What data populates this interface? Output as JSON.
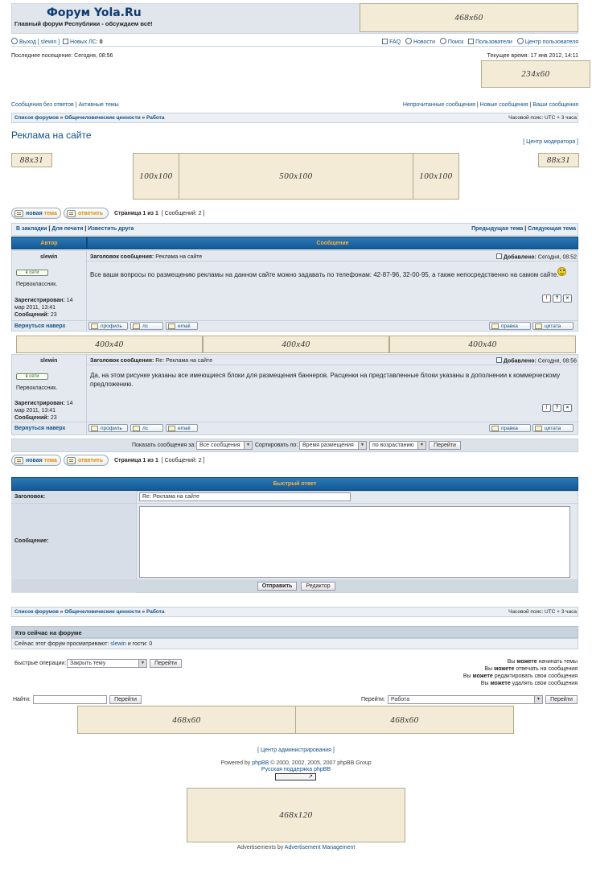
{
  "site": {
    "logo_title": "Форум Yola.Ru",
    "logo_subtitle": "Главный форум Республики - обсуждаем всё!"
  },
  "ads": {
    "top": "468x60",
    "right": "234x60",
    "small_left": "88x31",
    "small_right": "88x31",
    "box_left": "100x100",
    "box_center": "500x100",
    "box_right": "100x100",
    "between_1": "400x40",
    "between_2": "400x40",
    "between_3": "400x40",
    "bottom_left": "468x60",
    "bottom_right": "468x60",
    "footer": "468x120"
  },
  "topnav": {
    "logout": "Выход [ slewin ]",
    "new_pm_label": "Новых ЛС:",
    "new_pm_count": "0",
    "links": [
      "FAQ",
      "Новости",
      "Поиск",
      "Пользователи",
      "Центр пользователя"
    ]
  },
  "visit": {
    "last_visit": "Последнее посещение: Сегодня, 08:56",
    "current_time": "Текущее время: 17 янв 2012, 14:11"
  },
  "quicklinks": {
    "left_1": "Сообщения без ответов",
    "left_2": "Активные темы",
    "right_1": "Непрочитанные сообщения",
    "right_2": "Новые сообщения",
    "right_3": "Ваши сообщения"
  },
  "breadcrumb": {
    "items": [
      "Список форумов",
      "Общечеловеческие ценности",
      "Работа"
    ],
    "sep": "»",
    "timezone": "Часовой пояс: UTC + 3 часа"
  },
  "topic": {
    "title": "Реклама на сайте",
    "mod_center": "[ Центр модератора ]"
  },
  "buttons": {
    "new_topic_1": "новая",
    "new_topic_2": "тема",
    "reply": "ответить",
    "pagination": "Страница 1 из 1",
    "post_count": "[ Сообщений: 2 ]"
  },
  "toolbar": {
    "left_1": "В закладки",
    "left_2": "Для печати",
    "left_3": "Известить друга",
    "right_1": "Предыдущая тема",
    "right_2": "Следующая тема"
  },
  "table_header": {
    "author": "Автор",
    "message": "Сообщение"
  },
  "posts": [
    {
      "author": "slewin",
      "subject_label": "Заголовок сообщения:",
      "subject": "Реклама на сайте",
      "added_label": "Добавлено:",
      "added": "Сегодня, 08:52",
      "status": "в сети",
      "rank": "Первоклассник.",
      "reg_label": "Зарегистрирован:",
      "reg_date_1": "14",
      "reg_date_2": "мар 2011, 13:41",
      "msgs_label": "Сообщений:",
      "msgs": "23",
      "body": "Все ваши вопросы по размещению рекламы на данном сайте можно задавать по телефонам: 42-87-96, 32-00-95, а также непосредственно на самом сайте.",
      "back_top": "Вернуться наверх",
      "profile": "профиль",
      "pm": "лс",
      "email": "email",
      "edit": "правка",
      "quote": "цитата"
    },
    {
      "author": "slewin",
      "subject_label": "Заголовок сообщения:",
      "subject": "Re: Реклама на сайте",
      "added_label": "Добавлено:",
      "added": "Сегодня, 08:56",
      "status": "в сети",
      "rank": "Первоклассник.",
      "reg_label": "Зарегистрирован:",
      "reg_date_1": "14",
      "reg_date_2": "мар 2011, 13:41",
      "msgs_label": "Сообщений:",
      "msgs": "23",
      "body": "Да, на этом рисунке указаны все имеющиеся блоки для размещения баннеров. Расценки на представленные блоки указаны в дополнении к коммерческому предложению.",
      "back_top": "Вернуться наверх",
      "profile": "профиль",
      "pm": "лс",
      "email": "email",
      "edit": "правка",
      "quote": "цитата"
    }
  ],
  "sortbar": {
    "show_label": "Показать сообщения за:",
    "show_value": "Все сообщения",
    "sort_label": "Сортировать по:",
    "sort_value": "Время размещения",
    "order_value": "по возрастанию",
    "go": "Перейти"
  },
  "quick_reply": {
    "title": "Быстрый ответ",
    "subject_label": "Заголовок:",
    "subject_value": "Re: Реклама на сайте",
    "message_label": "Сообщение:",
    "send": "Отправить",
    "editor": "Редактор"
  },
  "online": {
    "title": "Кто сейчас на форуме",
    "text_1": "Сейчас этот форум просматривают:",
    "user": "slewin",
    "text_2": "и гости: 0"
  },
  "quick_ops": {
    "label": "Быстрые операции:",
    "value": "Закрыть тему",
    "go": "Перейти"
  },
  "perms": [
    {
      "pre": "Вы",
      "bold": "можете",
      "post": "начинать темы"
    },
    {
      "pre": "Вы",
      "bold": "можете",
      "post": "отвечать на сообщения"
    },
    {
      "pre": "Вы",
      "bold": "можете",
      "post": "редактировать свои сообщения"
    },
    {
      "pre": "Вы",
      "bold": "можете",
      "post": "удалять свои сообщения"
    }
  ],
  "search": {
    "label": "Найти:",
    "go": "Перейти",
    "jump_label": "Перейти:",
    "jump_value": "Работа",
    "jump_go": "Перейти"
  },
  "footer": {
    "admin": "[ Центр администрирования ]",
    "powered_1": "Powered by",
    "phpbb": "phpBB",
    "powered_2": "© 2000, 2002, 2005, 2007 phpBB Group",
    "russian": "Русская поддержка phpBB",
    "ads_1": "Advertisements by",
    "ads_2": "Advertisement Management"
  },
  "colors": {
    "accent": "#105289",
    "header_blue": "#115a98",
    "header_text": "#fbb13d",
    "ad_fill": "#f3ebd6",
    "row_bg": "#e4e9ef"
  }
}
